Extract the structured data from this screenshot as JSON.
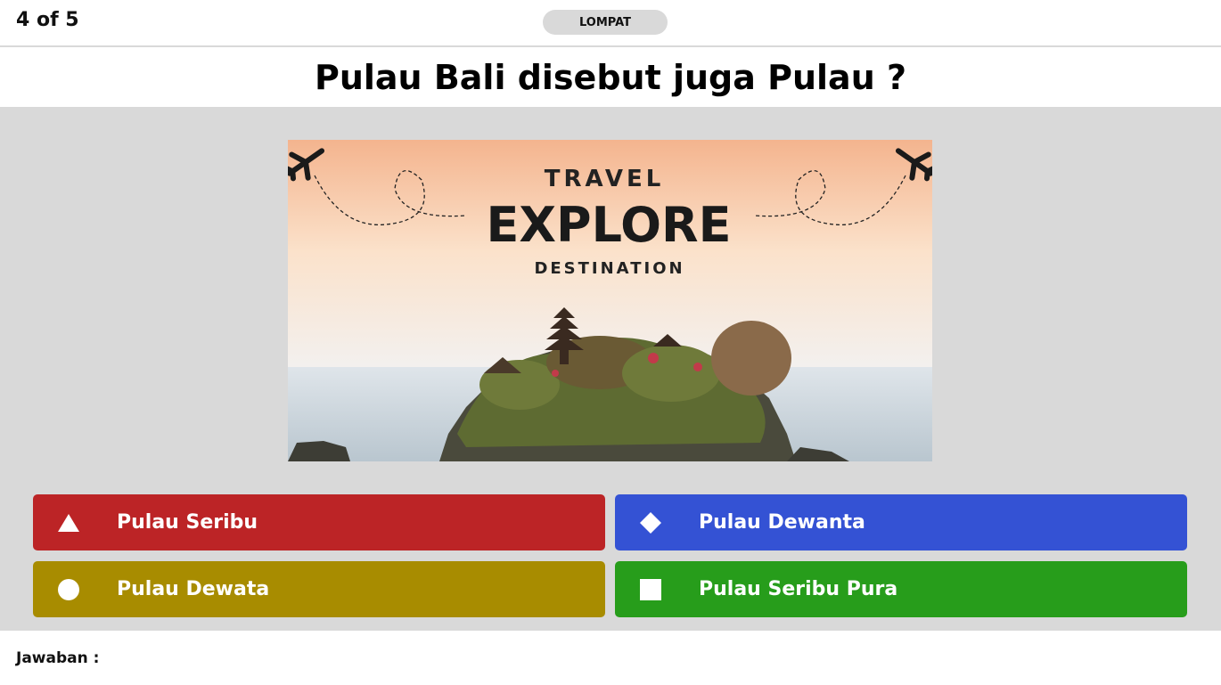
{
  "header": {
    "counter": "4 of 5",
    "skip_label": "LOMPAT"
  },
  "question": {
    "text": "Pulau Bali disebut juga Pulau ?"
  },
  "hero_image": {
    "line1": "TRAVEL",
    "line2": "EXPLORE",
    "line3": "DESTINATION",
    "icon": "airplane-icon"
  },
  "answers": [
    {
      "label": "Pulau Seribu",
      "shape": "triangle-icon",
      "color": "#bc2426"
    },
    {
      "label": "Pulau Dewanta",
      "shape": "diamond-icon",
      "color": "#3452d4"
    },
    {
      "label": "Pulau Dewata",
      "shape": "circle-icon",
      "color": "#a88c00"
    },
    {
      "label": "Pulau Seribu Pura",
      "shape": "square-icon",
      "color": "#279d1b"
    }
  ],
  "footer": {
    "answer_label": "Jawaban :"
  }
}
